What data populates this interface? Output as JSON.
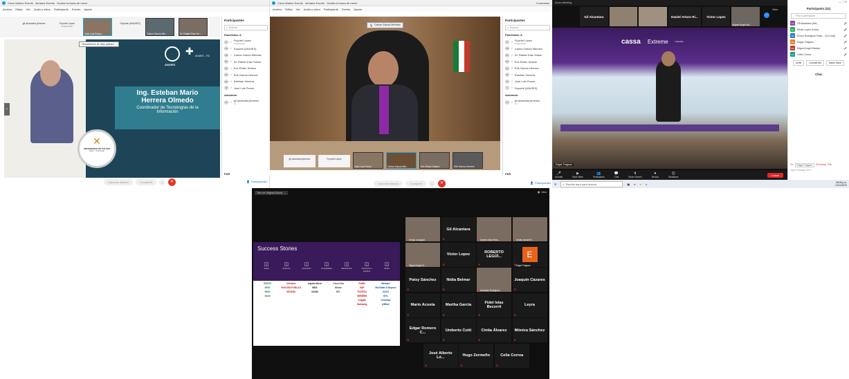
{
  "webex1": {
    "tabs": [
      "Cisco Webex Events",
      "Ventana Evento",
      "Ocultar la barra de menú"
    ],
    "conectado": "Conectado",
    "menu": [
      "Archivo",
      "Editar",
      "Ver",
      "Audio y video",
      "Participante",
      "Evento",
      "Ayuda"
    ],
    "thumbs": [
      {
        "label": "gil alcantara jimenez",
        "sub": "",
        "type": "blank"
      },
      {
        "label": "Fryzdel López",
        "sub": "Organizador",
        "type": "blank"
      },
      {
        "label": "José Luis Ponce",
        "sub": "",
        "type": "video"
      },
      {
        "label": "Soporte (ANUIES)",
        "sub": "",
        "type": "blank"
      },
      {
        "label": "Carlos García Mé...",
        "sub": "",
        "type": "video"
      },
      {
        "label": "Dr. Rafael Díaz So...",
        "sub": "",
        "type": "video"
      }
    ],
    "viewing_badge": "Visualización de la(s) aplicaci...",
    "slide": {
      "name_line1": "Ing. Esteban Mario",
      "name_line2": "Herrera Olmedo",
      "role_line1": "Coordinador de Tecnologías de la",
      "role_line2": "Información",
      "anuies": "ANUIES",
      "anuies_tic": "ANUIES - TIC",
      "univ": "UNIVERSIDAD DE XALAPA",
      "univ_sub": "Saber · Trascender"
    },
    "controls": {
      "mute": "Cancelar silencio",
      "share": "Compartir"
    },
    "participants_btn": "Participantes",
    "panel": {
      "title": "Participantes",
      "search": "Buscar",
      "panelists_header": "Panelistas: 8",
      "panelists": [
        {
          "initials": "FL",
          "name": "Fryzdel López",
          "sub": "Organizador"
        },
        {
          "initials": "SA",
          "name": "Soporte (ANUIES)",
          "sub": ""
        },
        {
          "initials": "CM",
          "name": "Carlos García Méndez",
          "sub": ""
        },
        {
          "initials": "DS",
          "name": "Dr. Rafael Díaz Sobac",
          "sub": ""
        },
        {
          "initials": "ES",
          "name": "Eric Efraín Solano",
          "sub": ""
        },
        {
          "initials": "EH",
          "name": "Erik García Herrera",
          "sub": ""
        },
        {
          "initials": "EH",
          "name": "Esteban Herrera",
          "sub": ""
        },
        {
          "initials": "JP",
          "name": "José Luis Ponce",
          "sub": ""
        }
      ],
      "attendees_header": "Asistente:",
      "attendees": [
        {
          "initials": "GJ",
          "name": "gil alcantara jimenez",
          "sub": "Yo"
        }
      ],
      "qa": "P&R"
    }
  },
  "webex2": {
    "tabs": [
      "Cisco Webex Events",
      "Ventana Evento",
      "Ocultar la barra de menú"
    ],
    "conectado": "Conectado",
    "menu": [
      "Archivo",
      "Editar",
      "Ver",
      "Audio y video",
      "Participante",
      "Evento",
      "Ayuda"
    ],
    "speaker_badge": "Carlos García Méndez",
    "strip": [
      {
        "label": "gil alcantara jimenez",
        "type": "blank"
      },
      {
        "label": "Fryzdel López",
        "type": "blank"
      },
      {
        "label": "José Luis Ponce",
        "type": "video"
      },
      {
        "label": "Carlos García Mé...",
        "type": "video"
      },
      {
        "label": "Eric Efraín Solano",
        "type": "video"
      },
      {
        "label": "Erik García Herrera",
        "type": "video"
      }
    ],
    "controls": {
      "mute": "Cancelar silencio",
      "share": "Compartir"
    },
    "participants_btn": "Participantes",
    "panel": {
      "title": "Participantes",
      "search": "Buscar",
      "panelists_header": "Panelistas: 8",
      "panelists": [
        {
          "initials": "FL",
          "name": "Fryzdel López",
          "sub": "Organizador"
        },
        {
          "initials": "CM",
          "name": "Carlos García Méndez",
          "sub": ""
        },
        {
          "initials": "DS",
          "name": "Dr. Rafael Díaz Sobac",
          "sub": ""
        },
        {
          "initials": "ES",
          "name": "Eric Efraín Solano",
          "sub": ""
        },
        {
          "initials": "EH",
          "name": "Erik García Herrera",
          "sub": ""
        },
        {
          "initials": "EH",
          "name": "Esteban Herrera",
          "sub": ""
        },
        {
          "initials": "JP",
          "name": "José Luis Ponce",
          "sub": ""
        },
        {
          "initials": "S",
          "name": "Soporte (ANUIES)",
          "sub": ""
        }
      ],
      "attendees_header": "Asistente:",
      "attendees": [
        {
          "initials": "GJ",
          "name": "gil alcantara jimenez",
          "sub": "Yo"
        }
      ],
      "qa": "P&R"
    }
  },
  "zoom1": {
    "title": "Zoom Meeting",
    "top_tiles": [
      {
        "label": "Gil Alcantara",
        "type": "name"
      },
      {
        "label": "",
        "type": "video"
      },
      {
        "label": "",
        "type": "video"
      },
      {
        "label": "Daniel Arturo Ri...",
        "type": "name"
      },
      {
        "label": "Victor Lopez",
        "type": "name"
      },
      {
        "label": "Miguel Angel Mu...",
        "type": "video"
      }
    ],
    "view_btn": "View",
    "sign_cassa": "cassa",
    "sign_extreme": "Extreme",
    "sign_extreme_sub": "networks",
    "speaker_name": "Edgar Fragoso",
    "toolbar": [
      {
        "icon": "🎤",
        "label": "Unmute"
      },
      {
        "icon": "▶",
        "label": "Start Video"
      },
      {
        "icon": "👥",
        "label": "Participants"
      },
      {
        "icon": "💬",
        "label": "Chat"
      },
      {
        "icon": "⬆",
        "label": "Share Screen"
      },
      {
        "icon": "⏺",
        "label": "Record"
      },
      {
        "icon": "☺",
        "label": "Reactions"
      }
    ],
    "leave": "Leave",
    "panel": {
      "title": "Participants (22)",
      "search": "Find a participant",
      "people": [
        {
          "initials": "GA",
          "name": "Gil Alcantara (Me)",
          "color": "#8e44ad"
        },
        {
          "initials": "EL",
          "name": "Efrain Lopez (Host)",
          "color": "#27ae60"
        },
        {
          "initials": "AR",
          "name": "Arturo Rodriguez Ross... (Co-host)",
          "color": "#2980b9"
        },
        {
          "initials": "EF",
          "name": "Edgar Fragoso",
          "color": "#e67e22"
        },
        {
          "initials": "MA",
          "name": "Miguel Angel Macias",
          "color": "#c0392b"
        },
        {
          "initials": "CC",
          "name": "Celia Correa",
          "color": "#16a085"
        }
      ],
      "buttons": [
        "Invite",
        "Unmute Me",
        "Raise Hand"
      ],
      "chat_title": "Chat",
      "to_label": "To:",
      "to_value": "Edgar Fragoso",
      "privately": "(Privately)",
      "file_btn": "File",
      "message_placeholder": "Type message here..."
    },
    "taskbar": {
      "search": "Escribe aquí para buscar",
      "time": "08:08 p.m.",
      "date": "14/10/2020"
    }
  },
  "zoom2": {
    "original_sound": "Turn on Original Sound",
    "view": "View",
    "slide": {
      "title": "Success Stories",
      "categories": [
        "Salud",
        "Gobierno",
        "Educación",
        "Hospitalidad",
        "Manufactura",
        "Transporte y logística",
        "Retail"
      ],
      "logos": [
        [
          "ISSSTE",
          "Infinitum",
          "Ingram Micro",
          "Coca-Cola",
          "FedEx",
          "Walmart"
        ],
        [
          "IMSS",
          "FUNCIÓN PÚBLICA",
          "INEA",
          "Westin",
          "SAP",
          "Bed Bath & Beyond"
        ],
        [
          "IMSS",
          "",
          "UNAM",
          "NFL",
          "FUJITSU",
          "OXXO"
        ],
        [
          "Alsea",
          "SEDENA",
          "",
          "",
          "SIEMENS",
          "DHL"
        ],
        [
          "",
          "",
          "",
          "",
          "Colgate",
          "Chedraui"
        ],
        [
          "",
          "",
          "",
          "",
          "Samsung",
          "jetBlue"
        ]
      ]
    },
    "tiles": [
      {
        "label": "Sergio cosagual",
        "name": "",
        "type": "video"
      },
      {
        "label": "",
        "name": "Gil Alcantara",
        "type": "name"
      },
      {
        "label": "Daniel arturo Rios...",
        "name": "",
        "type": "video"
      },
      {
        "label": "Tomás Ismael R...",
        "name": "",
        "type": "video"
      },
      {
        "label": "Miguel Angel M...",
        "name": "",
        "type": "video"
      },
      {
        "label": "",
        "name": "Victor Lopez",
        "type": "name"
      },
      {
        "label": "",
        "name": "ROBERTO LEGÜÍ...",
        "type": "name"
      },
      {
        "label": "Edgar Fragoso",
        "name": "E",
        "type": "letter"
      },
      {
        "label": "",
        "name": "Patsy Sánchez",
        "type": "name"
      },
      {
        "label": "",
        "name": "Nidia Belmar",
        "type": "name"
      },
      {
        "label": "Armando Rodriguez",
        "name": "",
        "type": "video"
      },
      {
        "label": "",
        "name": "Joaquín Cázares",
        "type": "name"
      },
      {
        "label": "",
        "name": "Mario Acosta",
        "type": "name"
      },
      {
        "label": "",
        "name": "Martha García",
        "type": "name"
      },
      {
        "label": "",
        "name": "Fidel Islas Becerril",
        "type": "name"
      },
      {
        "label": "",
        "name": "Leyra",
        "type": "name"
      },
      {
        "label": "",
        "name": "Edgar Romero C...",
        "type": "name"
      },
      {
        "label": "",
        "name": "Umberto Cotti",
        "type": "name"
      },
      {
        "label": "",
        "name": "Cintia Álvarez",
        "type": "name"
      },
      {
        "label": "",
        "name": "Mónica Sánchez",
        "type": "name"
      },
      {
        "label": "",
        "name": "José Alberto Ló...",
        "type": "name"
      },
      {
        "label": "",
        "name": "Hugo Zermeño",
        "type": "name"
      },
      {
        "label": "",
        "name": "Celia Correa",
        "type": "name"
      }
    ]
  }
}
